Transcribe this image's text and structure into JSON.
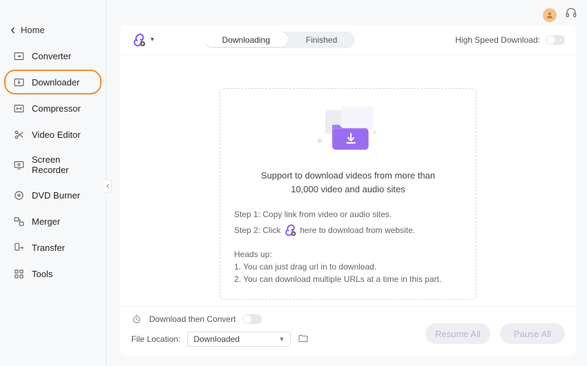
{
  "home_label": "Home",
  "sidebar": {
    "items": [
      {
        "label": "Converter"
      },
      {
        "label": "Downloader"
      },
      {
        "label": "Compressor"
      },
      {
        "label": "Video Editor"
      },
      {
        "label": "Screen Recorder"
      },
      {
        "label": "DVD Burner"
      },
      {
        "label": "Merger"
      },
      {
        "label": "Transfer"
      },
      {
        "label": "Tools"
      }
    ]
  },
  "tabs": {
    "downloading": "Downloading",
    "finished": "Finished"
  },
  "high_speed_label": "High Speed Download:",
  "drop": {
    "title": "Support to download videos from more than 10,000 video and audio sites",
    "step1": "Step 1: Copy link from video or audio sites.",
    "step2_a": "Step 2: Click",
    "step2_b": "here to download from website.",
    "heads_label": "Heads up:",
    "heads_1": "1. You can just drag url in to download.",
    "heads_2": "2. You can download multiple URLs at a time in this part."
  },
  "footer": {
    "convert_label": "Download then Convert",
    "location_label": "File Location:",
    "location_value": "Downloaded",
    "resume": "Resume All",
    "pause": "Pause All"
  }
}
